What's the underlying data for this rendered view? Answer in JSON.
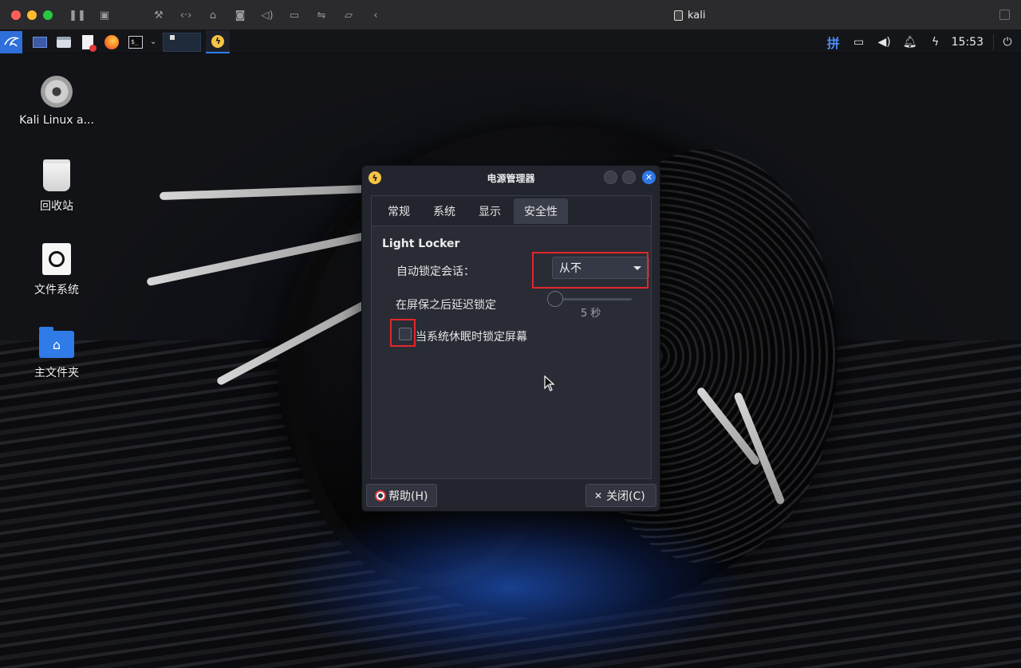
{
  "host": {
    "title": "kali"
  },
  "panel": {
    "clock": "15:53",
    "input_method": "拼"
  },
  "desktop_icons": [
    {
      "label": "Kali Linux a..."
    },
    {
      "label": "回收站"
    },
    {
      "label": "文件系统"
    },
    {
      "label": "主文件夹"
    }
  ],
  "dialog": {
    "title": "电源管理器",
    "tabs": [
      {
        "label": "常规"
      },
      {
        "label": "系统"
      },
      {
        "label": "显示"
      },
      {
        "label": "安全性"
      }
    ],
    "active_tab": "安全性",
    "section_title": "Light Locker",
    "auto_lock_label": "自动锁定会话：",
    "auto_lock_value": "从不",
    "delay_label": "在屏保之后延迟锁定",
    "delay_value": "5 秒",
    "lock_on_sleep_label": "当系统休眠时锁定屏幕",
    "lock_on_sleep_checked": false,
    "help_button": "帮助(H)",
    "close_button": "关闭(C)"
  },
  "colors": {
    "accent": "#2f7ef7",
    "highlight": "#e3262b"
  }
}
